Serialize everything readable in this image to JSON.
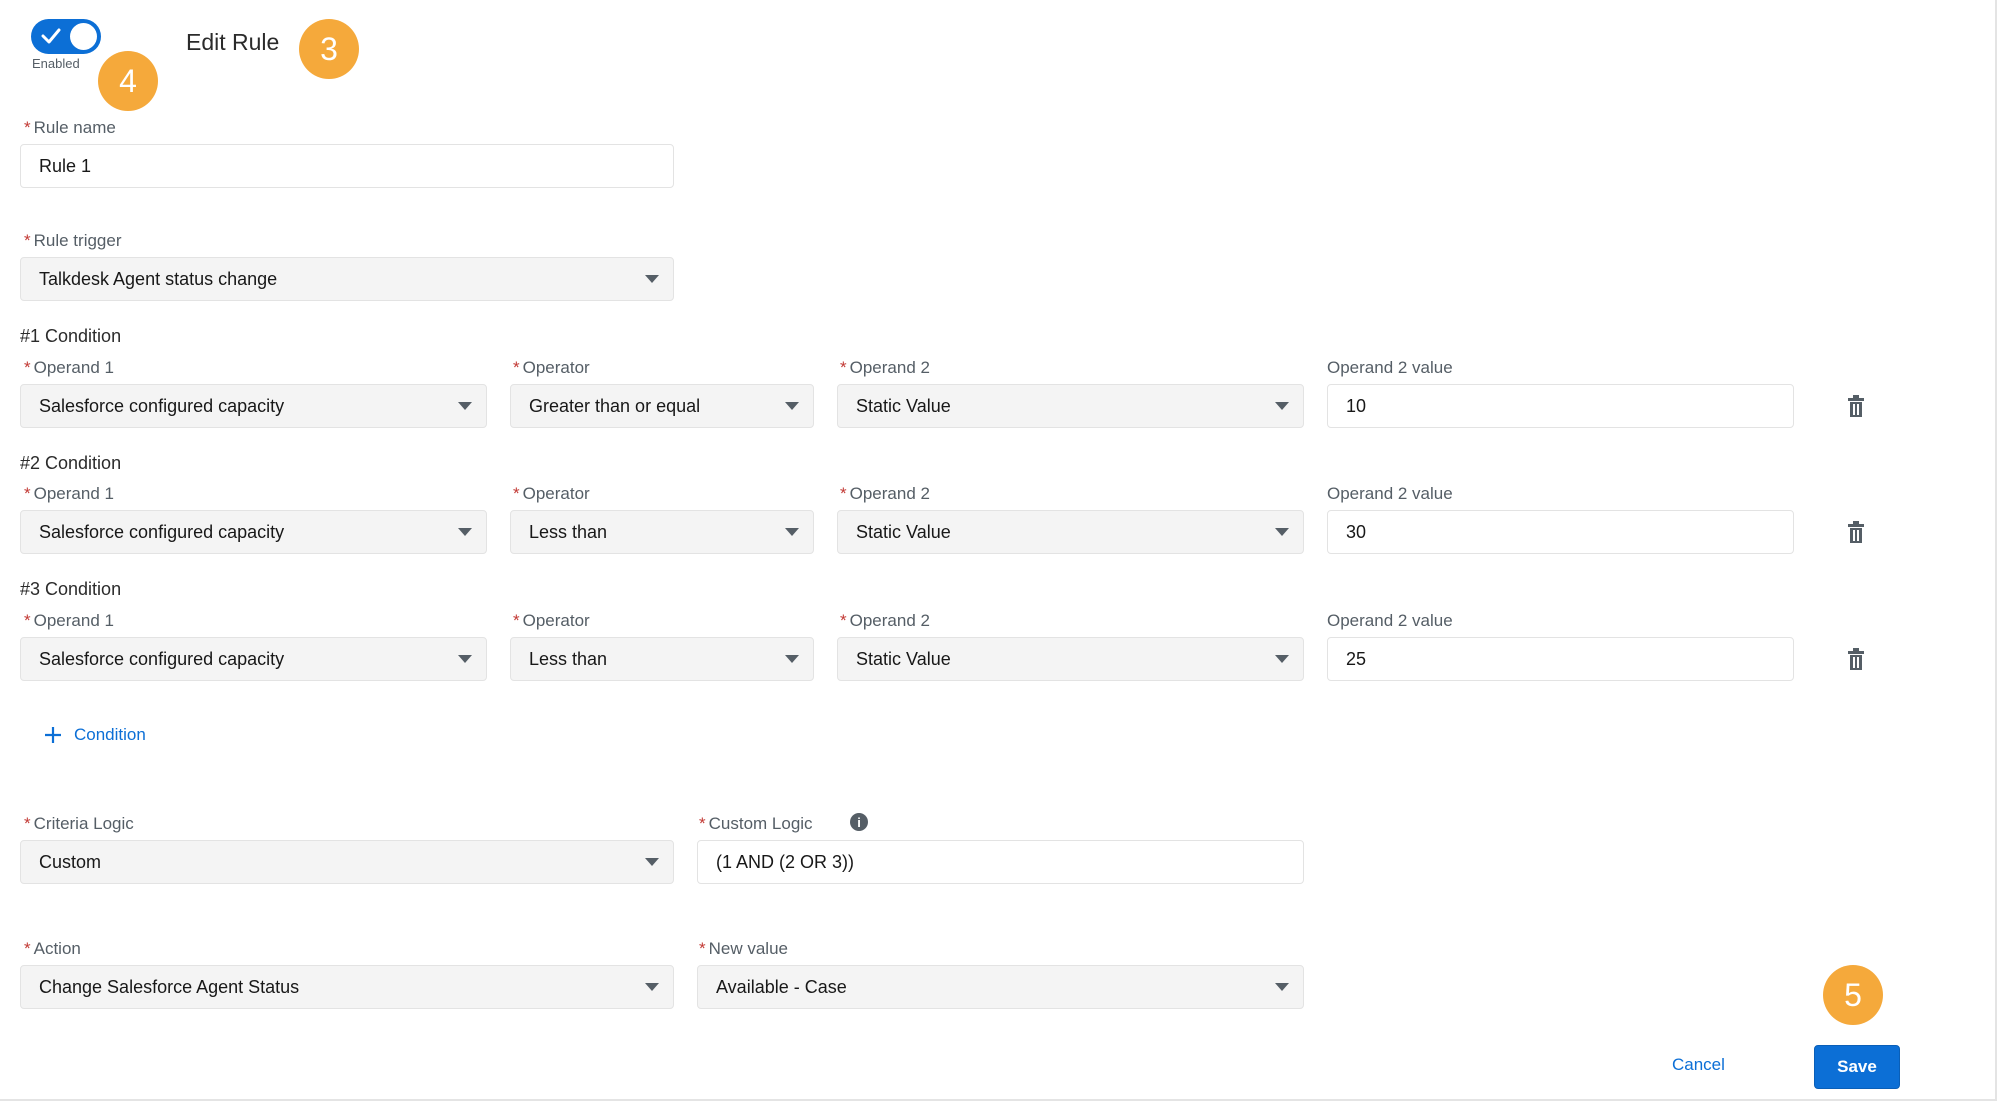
{
  "header": {
    "enabled_label": "Enabled",
    "enabled": true,
    "title": "Edit Rule"
  },
  "badges": {
    "b3": "3",
    "b4": "4",
    "b5": "5"
  },
  "rule_name": {
    "label": "Rule name",
    "value": "Rule 1"
  },
  "rule_trigger": {
    "label": "Rule trigger",
    "value": "Talkdesk Agent status change"
  },
  "conditions": [
    {
      "title": "#1 Condition",
      "operand1_label": "Operand 1",
      "operand1": "Salesforce configured capacity",
      "operator_label": "Operator",
      "operator": "Greater than or equal",
      "operand2_label": "Operand 2",
      "operand2": "Static Value",
      "operand2_value_label": "Operand 2 value",
      "operand2_value": "10"
    },
    {
      "title": "#2 Condition",
      "operand1_label": "Operand 1",
      "operand1": "Salesforce configured capacity",
      "operator_label": "Operator",
      "operator": "Less than",
      "operand2_label": "Operand 2",
      "operand2": "Static Value",
      "operand2_value_label": "Operand 2 value",
      "operand2_value": "30"
    },
    {
      "title": "#3 Condition",
      "operand1_label": "Operand 1",
      "operand1": "Salesforce configured capacity",
      "operator_label": "Operator",
      "operator": "Less than",
      "operand2_label": "Operand 2",
      "operand2": "Static Value",
      "operand2_value_label": "Operand 2 value",
      "operand2_value": "25"
    }
  ],
  "add_condition_label": "Condition",
  "criteria_logic": {
    "label": "Criteria Logic",
    "value": "Custom"
  },
  "custom_logic": {
    "label": "Custom Logic",
    "value": "(1 AND (2 OR 3))"
  },
  "action": {
    "label": "Action",
    "value": "Change Salesforce Agent Status"
  },
  "new_value": {
    "label": "New value",
    "value": "Available - Case"
  },
  "footer": {
    "cancel_label": "Cancel",
    "save_label": "Save"
  },
  "colors": {
    "accent": "#0c6fd6",
    "badge": "#f5a93b",
    "required": "#c23934"
  },
  "icons": [
    "check-icon",
    "trash-icon",
    "plus-icon",
    "info-icon",
    "caret-down-icon"
  ]
}
